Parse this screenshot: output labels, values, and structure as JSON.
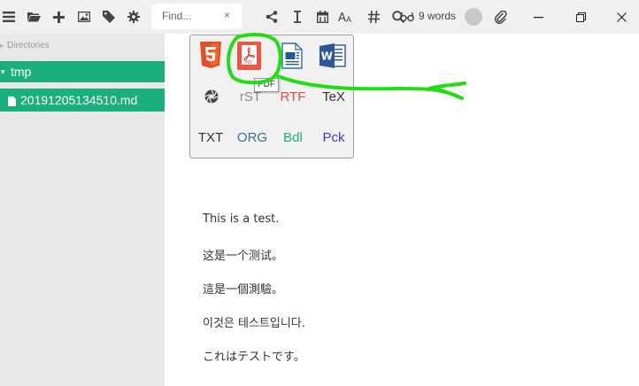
{
  "toolbar": {
    "find_placeholder": "Find...",
    "clear_glyph": "×",
    "word_count": "9 words",
    "icons": [
      "menu-icon",
      "folder-icon",
      "plus-icon",
      "image-icon",
      "tag-icon",
      "gear-icon",
      "share-icon",
      "text-cursor-icon",
      "calendar-icon",
      "font-size-icon",
      "hash-icon",
      "search-icon",
      "glasses-icon",
      "avatar",
      "paperclip-icon"
    ]
  },
  "window": {
    "minimize": "—",
    "maximize": "❐",
    "close": "✕"
  },
  "sidebar": {
    "header": "Directories",
    "directory": "tmp",
    "file": "20191205134510.md",
    "accent": "#1aaf7c"
  },
  "export_menu": {
    "row1": [
      "HTML5",
      "PDF",
      "ODT",
      "Word"
    ],
    "row2": [
      {
        "label": "",
        "icon": "aperture-icon",
        "color": "#444444"
      },
      {
        "label": "rST",
        "color": "#8a8a8a"
      },
      {
        "label": "RTF",
        "color": "#e04a3f"
      },
      {
        "label": "TeX",
        "color": "#333333"
      }
    ],
    "row3": [
      {
        "label": "TXT",
        "color": "#333333"
      },
      {
        "label": "ORG",
        "color": "#3a6f8f"
      },
      {
        "label": "Bdl",
        "color": "#1aaf7c"
      },
      {
        "label": "Pck",
        "color": "#3b3bd4"
      }
    ],
    "pdf_badge": "PDF",
    "tooltip": "PDF",
    "highlight_color": "#22dd11"
  },
  "editor": {
    "lines": [
      "This is a test.",
      "这是一个测试。",
      "這是一個測驗。",
      "이것은 테스트입니다.",
      "これはテストです。"
    ]
  }
}
